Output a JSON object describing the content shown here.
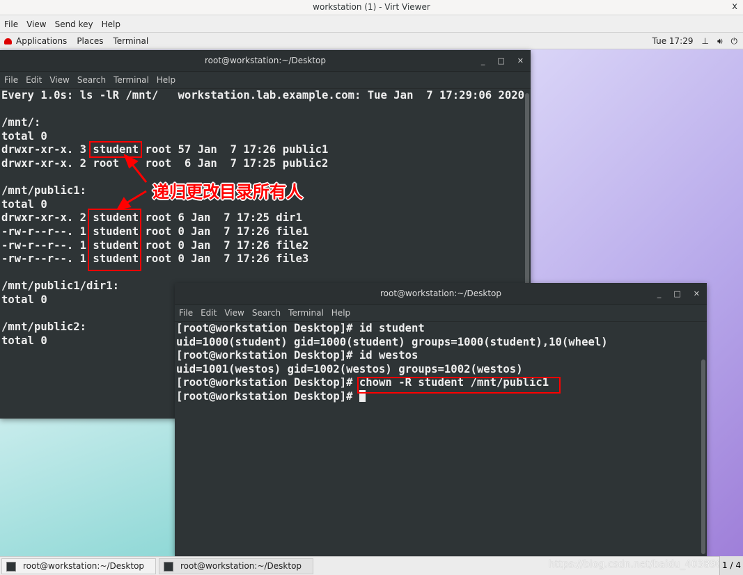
{
  "window": {
    "title": "workstation (1) - Virt Viewer",
    "close": "x"
  },
  "viewer_menu": [
    "File",
    "View",
    "Send key",
    "Help"
  ],
  "topbar": {
    "items": [
      "Applications",
      "Places",
      "Terminal"
    ],
    "clock": "Tue 17:29",
    "icons": [
      "network-icon",
      "volume-icon",
      "power-icon"
    ]
  },
  "term1": {
    "title": "root@workstation:~/Desktop",
    "menu": [
      "File",
      "Edit",
      "View",
      "Search",
      "Terminal",
      "Help"
    ],
    "lines": [
      "Every 1.0s: ls -lR /mnt/   workstation.lab.example.com: Tue Jan  7 17:29:06 2020",
      "",
      "/mnt/:",
      "total 0",
      "drwxr-xr-x. 3 student root 57 Jan  7 17:26 public1",
      "drwxr-xr-x. 2 root    root  6 Jan  7 17:25 public2",
      "",
      "/mnt/public1:",
      "total 0",
      "drwxr-xr-x. 2 student root 6 Jan  7 17:25 dir1",
      "-rw-r--r--. 1 student root 0 Jan  7 17:26 file1",
      "-rw-r--r--. 1 student root 0 Jan  7 17:26 file2",
      "-rw-r--r--. 1 student root 0 Jan  7 17:26 file3",
      "",
      "/mnt/public1/dir1:",
      "total 0",
      "",
      "/mnt/public2:",
      "total 0"
    ]
  },
  "term2": {
    "title": "root@workstation:~/Desktop",
    "menu": [
      "File",
      "Edit",
      "View",
      "Search",
      "Terminal",
      "Help"
    ],
    "lines": [
      "[root@workstation Desktop]# id student",
      "uid=1000(student) gid=1000(student) groups=1000(student),10(wheel)",
      "[root@workstation Desktop]# id westos",
      "uid=1001(westos) gid=1002(westos) groups=1002(westos)",
      "[root@workstation Desktop]# chown -R student /mnt/public1",
      "[root@workstation Desktop]# "
    ]
  },
  "annotation": "递归更改目录所有人",
  "annotation_color": "#ff0000",
  "taskbar": {
    "tasks": [
      "root@workstation:~/Desktop",
      "root@workstation:~/Desktop"
    ],
    "pager": "1 / 4"
  },
  "watermark": "https://blog.csdn.net/baidu_40389082"
}
